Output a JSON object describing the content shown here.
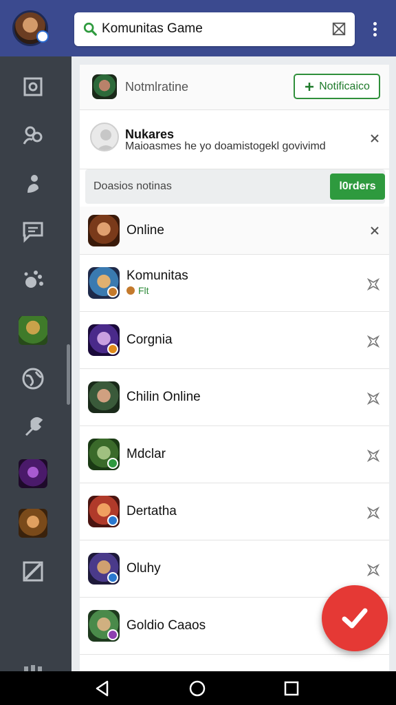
{
  "topbar": {
    "search_text": "Komunitas Game",
    "search_icon": "search-icon",
    "clear_icon": "close-box-icon",
    "more_icon": "more-vert-icon",
    "colors": {
      "bar": "#3b4a8f",
      "search_icon": "#2e9a3e"
    }
  },
  "sidebar": {
    "icons": [
      "screenshot-icon",
      "people-icon",
      "person-icon",
      "chat-icon",
      "settings-icon",
      "game-thumb",
      "globe-icon",
      "tool-icon",
      "game-thumb",
      "game-thumb",
      "edit-icon"
    ]
  },
  "header": {
    "text": "Notmlratine",
    "button_label": "Notificaico"
  },
  "message": {
    "title": "Nukares",
    "body": "Maioasmes he yo doamistogekl govivimd"
  },
  "filter": {
    "text": "Doasios notinas",
    "button_label": "l0rders"
  },
  "online": {
    "name": "Online"
  },
  "games": [
    {
      "name": "Komunitas",
      "sub": "Flt",
      "badge": "#c47a2c"
    },
    {
      "name": "Corgnia",
      "badge": "#e08a1a"
    },
    {
      "name": "Chilin Online",
      "badge": ""
    },
    {
      "name": "Mdclar",
      "badge": "#2e9a3e"
    },
    {
      "name": "Dertatha",
      "badge": "#2a78d0"
    },
    {
      "name": "Oluhy",
      "badge": "#2a78d0"
    },
    {
      "name": "Goldio Caaos",
      "badge": "#8e3fb0"
    }
  ],
  "fab": {
    "icon": "checkmark-icon",
    "color": "#e53935"
  },
  "navbar": {
    "icons": [
      "back-icon",
      "home-icon",
      "recents-icon"
    ]
  }
}
